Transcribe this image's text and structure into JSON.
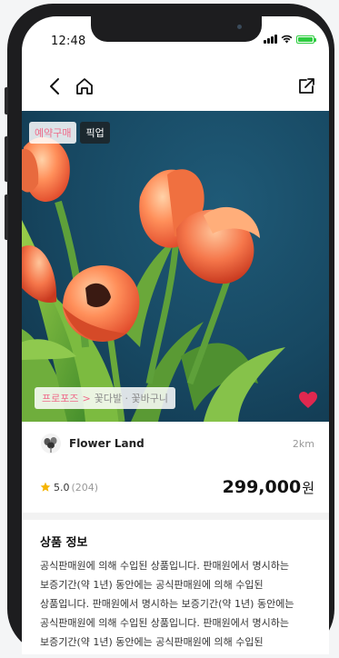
{
  "status": {
    "time": "12:48"
  },
  "nav": {
    "back_icon": "chevron-left-icon",
    "home_icon": "home-icon",
    "share_icon": "share-icon"
  },
  "hero": {
    "badges": [
      "예약구매",
      "픽업"
    ],
    "breadcrumb": {
      "category": "프로포즈",
      "separator": ">",
      "subcategory": "꽃다발 · 꽃바구니"
    },
    "liked": true
  },
  "seller": {
    "name": "Flower Land",
    "distance": "2km"
  },
  "product": {
    "rating": "5.0",
    "review_count": "(204)",
    "price": "299,000",
    "price_unit": "원"
  },
  "info": {
    "title": "상품 정보",
    "body": "공식판매원에 의해 수입된 상품입니다. 판매원에서 명시하는 보증기간(약 1년) 동안에는 공식판매원에 의해 수입된 상품입니다. 판매원에서 명시하는 보증기간(약 1년) 동안에는 공식판매원에 의해 수입된 상품입니다. 판매원에서 명시하는 보증기간(약 1년) 동안에는 공식판매원에 의해 수입된 상품입니다."
  },
  "colors": {
    "accent_pink": "#ef6b8a",
    "heart": "#e0284f",
    "star": "#f5b400"
  }
}
